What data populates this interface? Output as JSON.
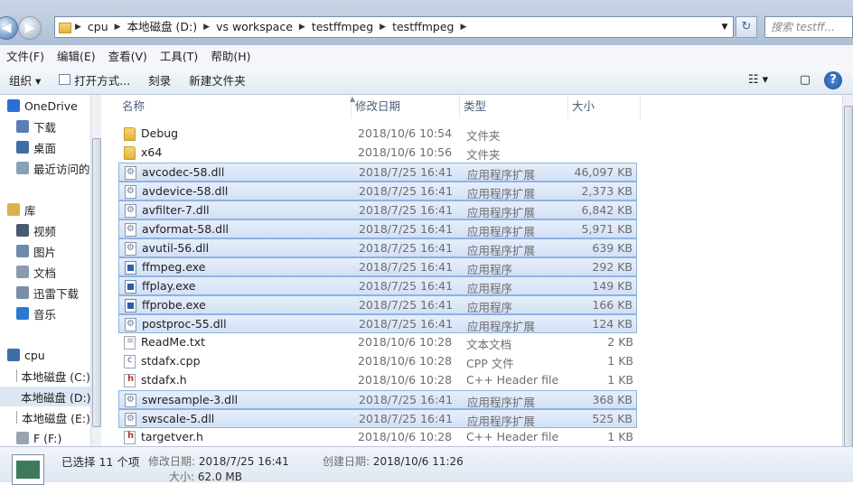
{
  "address": {
    "segments": [
      "cpu",
      "本地磁盘 (D:)",
      "vs workspace",
      "testffmpeg",
      "testffmpeg"
    ],
    "search_placeholder": "搜索 testff..."
  },
  "menu": [
    "文件(F)",
    "编辑(E)",
    "查看(V)",
    "工具(T)",
    "帮助(H)"
  ],
  "toolbar": {
    "organize": "组织 ▾",
    "open_with": "打开方式...",
    "burn": "刻录",
    "new_folder": "新建文件夹"
  },
  "sidebar": [
    {
      "label": "OneDrive",
      "icon": "cloud-icon",
      "color": "#2b6fd6"
    },
    {
      "label": "下载",
      "icon": "downloads-icon",
      "color": "#5a7fb8"
    },
    {
      "label": "桌面",
      "icon": "desktop-icon",
      "color": "#3d6ea6"
    },
    {
      "label": "最近访问的",
      "icon": "recent-icon",
      "color": "#8aa0b8"
    },
    {
      "label": "库",
      "icon": "library-icon",
      "color": "#d9b24a"
    },
    {
      "label": "视频",
      "icon": "video-icon",
      "color": "#4a5a6e"
    },
    {
      "label": "图片",
      "icon": "pictures-icon",
      "color": "#6e8aa8"
    },
    {
      "label": "文档",
      "icon": "documents-icon",
      "color": "#8a9ab0"
    },
    {
      "label": "迅雷下载",
      "icon": "thunder-download-icon",
      "color": "#7a8ea8"
    },
    {
      "label": "音乐",
      "icon": "music-icon",
      "color": "#2b7ad0"
    },
    {
      "label": "cpu",
      "icon": "computer-icon",
      "color": "#3c6fa8"
    },
    {
      "label": "本地磁盘 (C:)",
      "icon": "drive-icon",
      "color": "#9aa4b0"
    },
    {
      "label": "本地磁盘 (D:)",
      "icon": "drive-icon",
      "color": "#9aa4b0"
    },
    {
      "label": "本地磁盘 (E:)",
      "icon": "drive-icon",
      "color": "#9aa4b0"
    },
    {
      "label": "F (F:)",
      "icon": "drive-icon",
      "color": "#9aa4b0"
    }
  ],
  "columns": {
    "name": "名称",
    "date": "修改日期",
    "type": "类型",
    "size": "大小"
  },
  "files": [
    {
      "name": "Debug",
      "date": "2018/10/6 10:54",
      "type": "文件夹",
      "size": "",
      "icon": "folder-icon",
      "kind": "folder",
      "selected": false
    },
    {
      "name": "x64",
      "date": "2018/10/6 10:56",
      "type": "文件夹",
      "size": "",
      "icon": "folder-icon",
      "kind": "folder",
      "selected": false
    },
    {
      "name": "avcodec-58.dll",
      "date": "2018/7/25 16:41",
      "type": "应用程序扩展",
      "size": "46,097 KB",
      "icon": "dll-icon",
      "kind": "dll",
      "selected": true
    },
    {
      "name": "avdevice-58.dll",
      "date": "2018/7/25 16:41",
      "type": "应用程序扩展",
      "size": "2,373 KB",
      "icon": "dll-icon",
      "kind": "dll",
      "selected": true
    },
    {
      "name": "avfilter-7.dll",
      "date": "2018/7/25 16:41",
      "type": "应用程序扩展",
      "size": "6,842 KB",
      "icon": "dll-icon",
      "kind": "dll",
      "selected": true
    },
    {
      "name": "avformat-58.dll",
      "date": "2018/7/25 16:41",
      "type": "应用程序扩展",
      "size": "5,971 KB",
      "icon": "dll-icon",
      "kind": "dll",
      "selected": true
    },
    {
      "name": "avutil-56.dll",
      "date": "2018/7/25 16:41",
      "type": "应用程序扩展",
      "size": "639 KB",
      "icon": "dll-icon",
      "kind": "dll",
      "selected": true
    },
    {
      "name": "ffmpeg.exe",
      "date": "2018/7/25 16:41",
      "type": "应用程序",
      "size": "292 KB",
      "icon": "exe-icon",
      "kind": "exe",
      "selected": true
    },
    {
      "name": "ffplay.exe",
      "date": "2018/7/25 16:41",
      "type": "应用程序",
      "size": "149 KB",
      "icon": "exe-icon",
      "kind": "exe",
      "selected": true
    },
    {
      "name": "ffprobe.exe",
      "date": "2018/7/25 16:41",
      "type": "应用程序",
      "size": "166 KB",
      "icon": "exe-icon",
      "kind": "exe",
      "selected": true
    },
    {
      "name": "postproc-55.dll",
      "date": "2018/7/25 16:41",
      "type": "应用程序扩展",
      "size": "124 KB",
      "icon": "dll-icon",
      "kind": "dll",
      "selected": true
    },
    {
      "name": "ReadMe.txt",
      "date": "2018/10/6 10:28",
      "type": "文本文档",
      "size": "2 KB",
      "icon": "text-file-icon",
      "kind": "txt",
      "selected": false
    },
    {
      "name": "stdafx.cpp",
      "date": "2018/10/6 10:28",
      "type": "CPP 文件",
      "size": "1 KB",
      "icon": "cpp-file-icon",
      "kind": "cpp",
      "selected": false
    },
    {
      "name": "stdafx.h",
      "date": "2018/10/6 10:28",
      "type": "C++ Header file",
      "size": "1 KB",
      "icon": "header-file-icon",
      "kind": "h",
      "selected": false
    },
    {
      "name": "swresample-3.dll",
      "date": "2018/7/25 16:41",
      "type": "应用程序扩展",
      "size": "368 KB",
      "icon": "dll-icon",
      "kind": "dll",
      "selected": true
    },
    {
      "name": "swscale-5.dll",
      "date": "2018/7/25 16:41",
      "type": "应用程序扩展",
      "size": "525 KB",
      "icon": "dll-icon",
      "kind": "dll",
      "selected": true
    },
    {
      "name": "targetver.h",
      "date": "2018/10/6 10:28",
      "type": "C++ Header file",
      "size": "1 KB",
      "icon": "header-file-icon",
      "kind": "h",
      "selected": false
    }
  ],
  "status": {
    "selected_count": "已选择 11 个项",
    "modified_label": "修改日期:",
    "modified_value": "2018/7/25 16:41",
    "created_label": "创建日期:",
    "created_value": "2018/10/6 11:26",
    "size_label": "大小:",
    "size_value": "62.0 MB"
  }
}
